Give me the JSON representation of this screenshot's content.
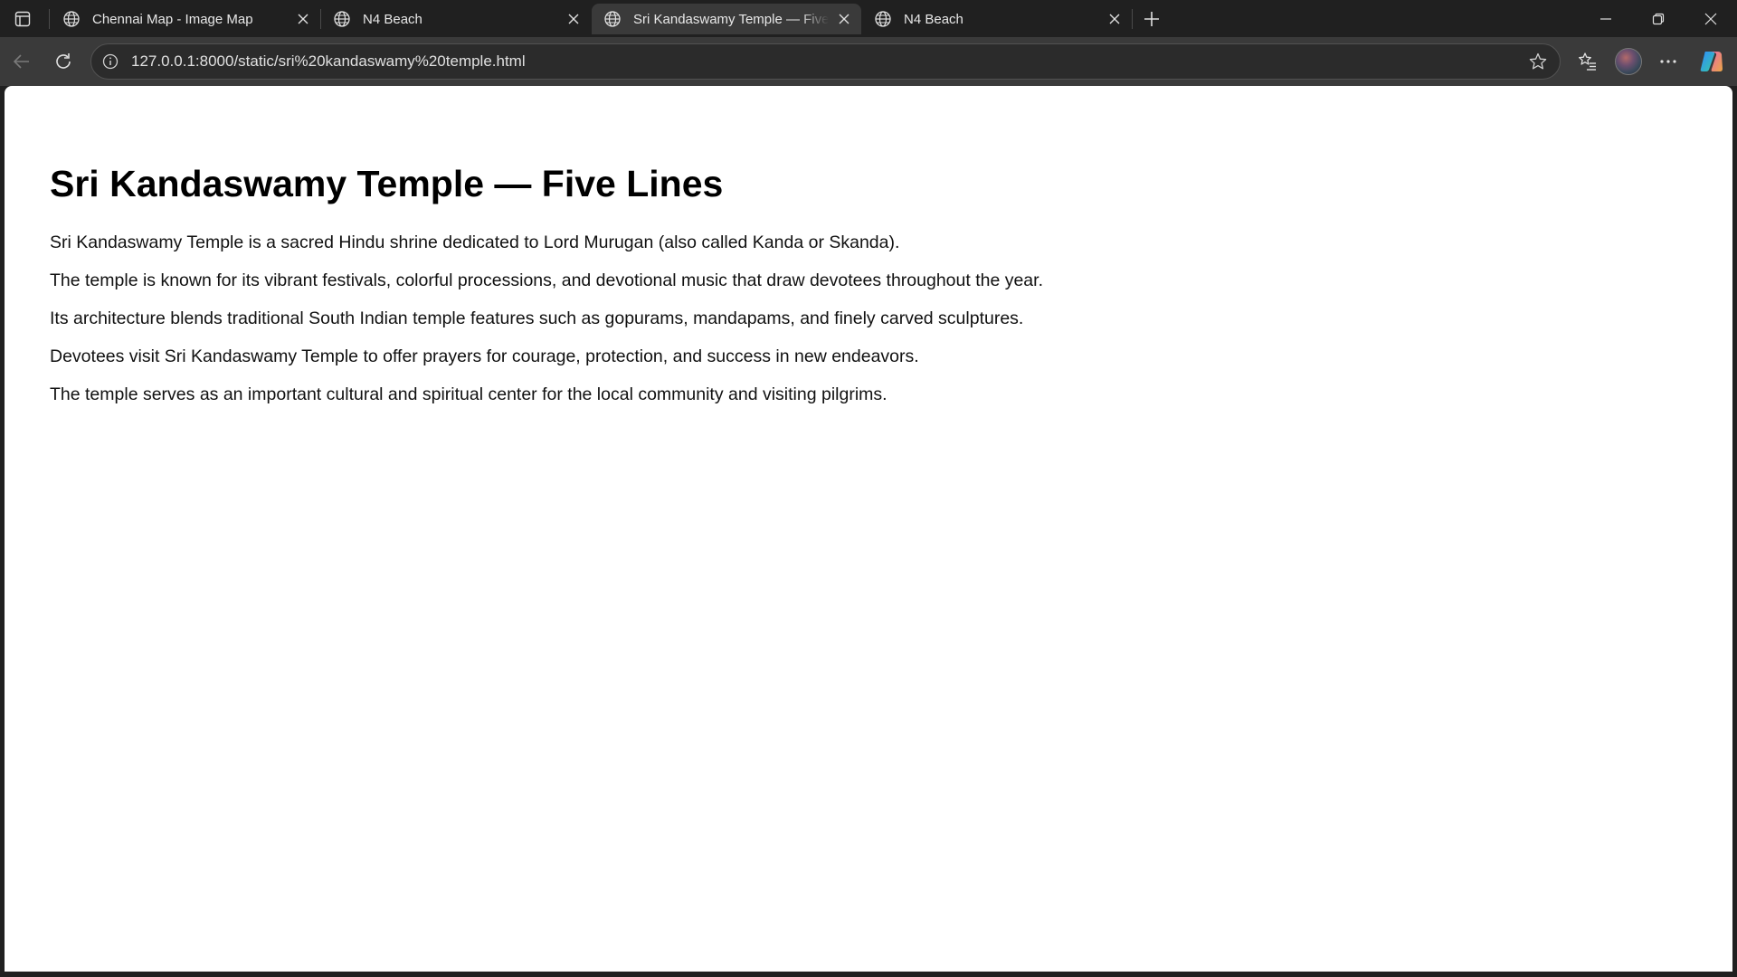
{
  "browser": {
    "tabs": [
      {
        "title": "Chennai Map - Image Map",
        "active": false
      },
      {
        "title": "N4 Beach",
        "active": false
      },
      {
        "title": "Sri Kandaswamy Temple — Five Lines",
        "active": true
      },
      {
        "title": "N4 Beach",
        "active": false
      }
    ],
    "address_bar": {
      "url": "127.0.0.1:8000/static/sri%20kandaswamy%20temple.html"
    }
  },
  "page": {
    "heading": "Sri Kandaswamy Temple — Five Lines",
    "lines": [
      "Sri Kandaswamy Temple is a sacred Hindu shrine dedicated to Lord Murugan (also called Kanda or Skanda).",
      "The temple is known for its vibrant festivals, colorful processions, and devotional music that draw devotees throughout the year.",
      "Its architecture blends traditional South Indian temple features such as gopurams, mandapams, and finely carved sculptures.",
      "Devotees visit Sri Kandaswamy Temple to offer prayers for courage, protection, and success in new endeavors.",
      "The temple serves as an important cultural and spiritual center for the local community and visiting pilgrims."
    ]
  },
  "colors": {
    "chrome_dark": "#202020",
    "toolbar": "#3a3a3a",
    "page_bg": "#ffffff",
    "text": "#000000"
  }
}
